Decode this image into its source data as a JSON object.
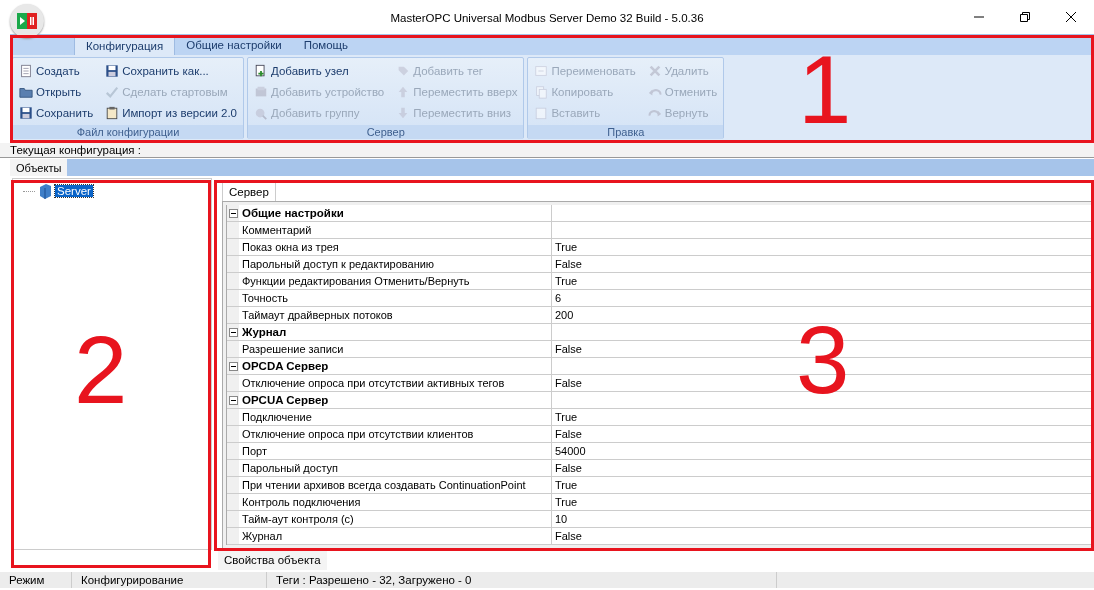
{
  "window": {
    "title": "MasterOPC Universal Modbus Server Demo 32 Build - 5.0.36"
  },
  "ribbon": {
    "tabs": [
      {
        "label": "Конфигурация",
        "selected": true
      },
      {
        "label": "Общие настройки",
        "selected": false
      },
      {
        "label": "Помощь",
        "selected": false
      }
    ],
    "groups": [
      {
        "label": "Файл конфигурации",
        "buttons": [
          {
            "label": "Создать",
            "disabled": false
          },
          {
            "label": "Открыть",
            "disabled": false
          },
          {
            "label": "Сохранить",
            "disabled": false
          },
          {
            "label": "Сохранить как...",
            "disabled": false
          },
          {
            "label": "Сделать стартовым",
            "disabled": true
          },
          {
            "label": "Импорт из версии 2.0",
            "disabled": false
          }
        ]
      },
      {
        "label": "Сервер",
        "buttons": [
          {
            "label": "Добавить узел",
            "disabled": false
          },
          {
            "label": "Добавить устройство",
            "disabled": true
          },
          {
            "label": "Добавить группу",
            "disabled": true
          },
          {
            "label": "Добавить тег",
            "disabled": true
          },
          {
            "label": "Переместить вверх",
            "disabled": true
          },
          {
            "label": "Переместить вниз",
            "disabled": true
          }
        ]
      },
      {
        "label": "Правка",
        "buttons": [
          {
            "label": "Переименовать",
            "disabled": true
          },
          {
            "label": "Копировать",
            "disabled": true
          },
          {
            "label": "Вставить",
            "disabled": true
          },
          {
            "label": "Удалить",
            "disabled": true
          },
          {
            "label": "Отменить",
            "disabled": true
          },
          {
            "label": "Вернуть",
            "disabled": true
          }
        ]
      }
    ]
  },
  "current_config": {
    "label": "Текущая конфигурация :"
  },
  "objects_tab": {
    "label": "Объекты",
    "selected": true
  },
  "tree": {
    "items": [
      {
        "label": "Server",
        "selected": true
      }
    ]
  },
  "properties": {
    "tab": {
      "label": "Сервер",
      "selected": true
    },
    "categories": [
      {
        "name": "Общие настройки",
        "expanded": true,
        "rows": [
          {
            "name": "Комментарий"
          },
          {
            "name": "Показ окна из трея",
            "value": "True"
          },
          {
            "name": "Парольный доступ к редактированию",
            "value": "False"
          },
          {
            "name": "Функции редактирования Отменить/Вернуть",
            "value": "True"
          },
          {
            "name": "Точность",
            "value": "6"
          },
          {
            "name": "Таймаут драйверных потоков",
            "value": "200"
          }
        ]
      },
      {
        "name": "Журнал",
        "expanded": true,
        "rows": [
          {
            "name": "Разрешение записи",
            "value": "False"
          }
        ]
      },
      {
        "name": "OPCDA Сервер",
        "expanded": true,
        "rows": [
          {
            "name": "Отключение опроса при отсутствии активных тегов",
            "value": "False"
          }
        ]
      },
      {
        "name": "OPCUA Сервер",
        "expanded": true,
        "rows": [
          {
            "name": "Подключение",
            "value": "True"
          },
          {
            "name": "Отключение опроса при отсутствии клиентов",
            "value": "False"
          },
          {
            "name": "Порт",
            "value": "54000"
          },
          {
            "name": "Парольный доступ",
            "value": "False"
          },
          {
            "name": "При чтении архивов всегда создавать ContinuationPoint",
            "value": "True"
          },
          {
            "name": "Контроль подключения",
            "value": "True"
          },
          {
            "name": "Тайм-аут контроля (с)",
            "value": "10"
          },
          {
            "name": "Журнал",
            "value": "False"
          }
        ]
      }
    ]
  },
  "bottom_tab": {
    "label": "Свойства объекта"
  },
  "status_bar": [
    "Режим",
    "Конфигурирование",
    "Теги : Разрешено - 32, Загружено - 0"
  ],
  "callouts": [
    {
      "number": "1"
    },
    {
      "number": "2"
    },
    {
      "number": "3"
    }
  ]
}
